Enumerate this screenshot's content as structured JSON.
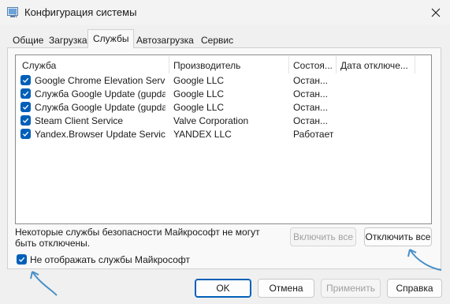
{
  "window": {
    "title": "Конфигурация системы",
    "icon": "system-config-icon"
  },
  "tabs": [
    {
      "label": "Общие",
      "active": false
    },
    {
      "label": "Загрузка",
      "active": false
    },
    {
      "label": "Службы",
      "active": true
    },
    {
      "label": "Автозагрузка",
      "active": false
    },
    {
      "label": "Сервис",
      "active": false
    }
  ],
  "services": {
    "columns": [
      "Служба",
      "Производитель",
      "Состоя...",
      "Дата отключе..."
    ],
    "rows": [
      {
        "checked": true,
        "name": "Google Chrome Elevation Servic...",
        "vendor": "Google LLC",
        "status": "Остан...",
        "date": ""
      },
      {
        "checked": true,
        "name": "Служба Google Update (gupdate)",
        "vendor": "Google LLC",
        "status": "Остан...",
        "date": ""
      },
      {
        "checked": true,
        "name": "Служба Google Update (gupdate...",
        "vendor": "Google LLC",
        "status": "Остан...",
        "date": ""
      },
      {
        "checked": true,
        "name": "Steam Client Service",
        "vendor": "Valve Corporation",
        "status": "Остан...",
        "date": ""
      },
      {
        "checked": true,
        "name": "Yandex.Browser Update Service",
        "vendor": "YANDEX LLC",
        "status": "Работает",
        "date": ""
      }
    ]
  },
  "note": "Некоторые службы безопасности Майкрософт не могут быть отключены.",
  "enable_all_label": "Включить все",
  "disable_all_label": "Отключить все",
  "hide_ms": {
    "label": "Не отображать службы Майкрософт",
    "checked": true
  },
  "footer": {
    "ok": "OK",
    "cancel": "Отмена",
    "apply": "Применить",
    "help": "Справка"
  },
  "colors": {
    "accent": "#005fb8",
    "annotation_arrow": "#4a90c8"
  }
}
